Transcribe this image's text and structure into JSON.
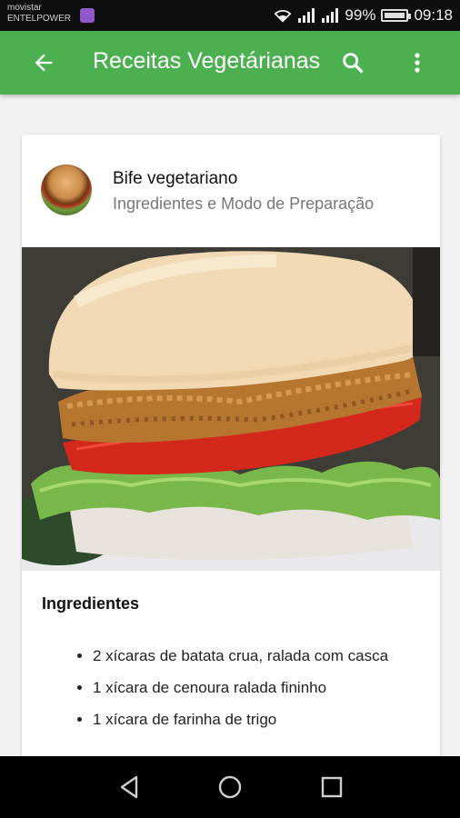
{
  "status_bar": {
    "carrier_line1": "movistar",
    "carrier_line2": "ENTELPOWER",
    "battery_percent": "99%",
    "time": "09:18"
  },
  "app_bar": {
    "title": "Receitas Vegetárianas",
    "color": "#4caf50",
    "back_icon": "arrow-back-icon",
    "search_icon": "search-icon",
    "menu_icon": "more-vert-icon"
  },
  "card": {
    "title": "Bife vegetariano",
    "subtitle": "Ingredientes e Modo de Preparação",
    "ingredients_heading": "Ingredientes",
    "ingredients": [
      "2 xícaras de batata crua, ralada com casca",
      "1 xícara de cenoura ralada fininho",
      "1 xícara de farinha de trigo"
    ]
  },
  "nav_bar": {
    "back_icon": "nav-back-icon",
    "home_icon": "nav-home-icon",
    "recents_icon": "nav-recents-icon"
  }
}
